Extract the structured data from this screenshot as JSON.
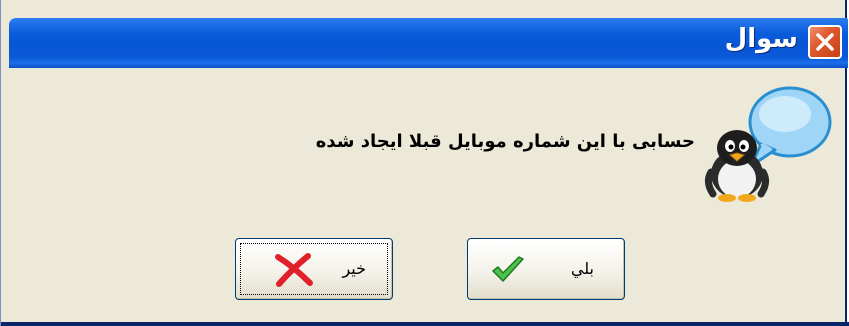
{
  "window": {
    "title": "سوال",
    "close_icon": "close-icon"
  },
  "message": {
    "text": "حسابی با این شماره موبایل قبلا ایجاد شده",
    "icon": "penguin-question-icon"
  },
  "buttons": {
    "yes_label": "بلي",
    "yes_icon": "check-icon",
    "no_label": "خير",
    "no_icon": "x-icon"
  },
  "colors": {
    "titlebar": "#0a5ddc",
    "dialog_bg": "#ece9d8",
    "close_button": "#e05a2c",
    "check": "#3aa63a",
    "x_mark": "#e0202a"
  }
}
